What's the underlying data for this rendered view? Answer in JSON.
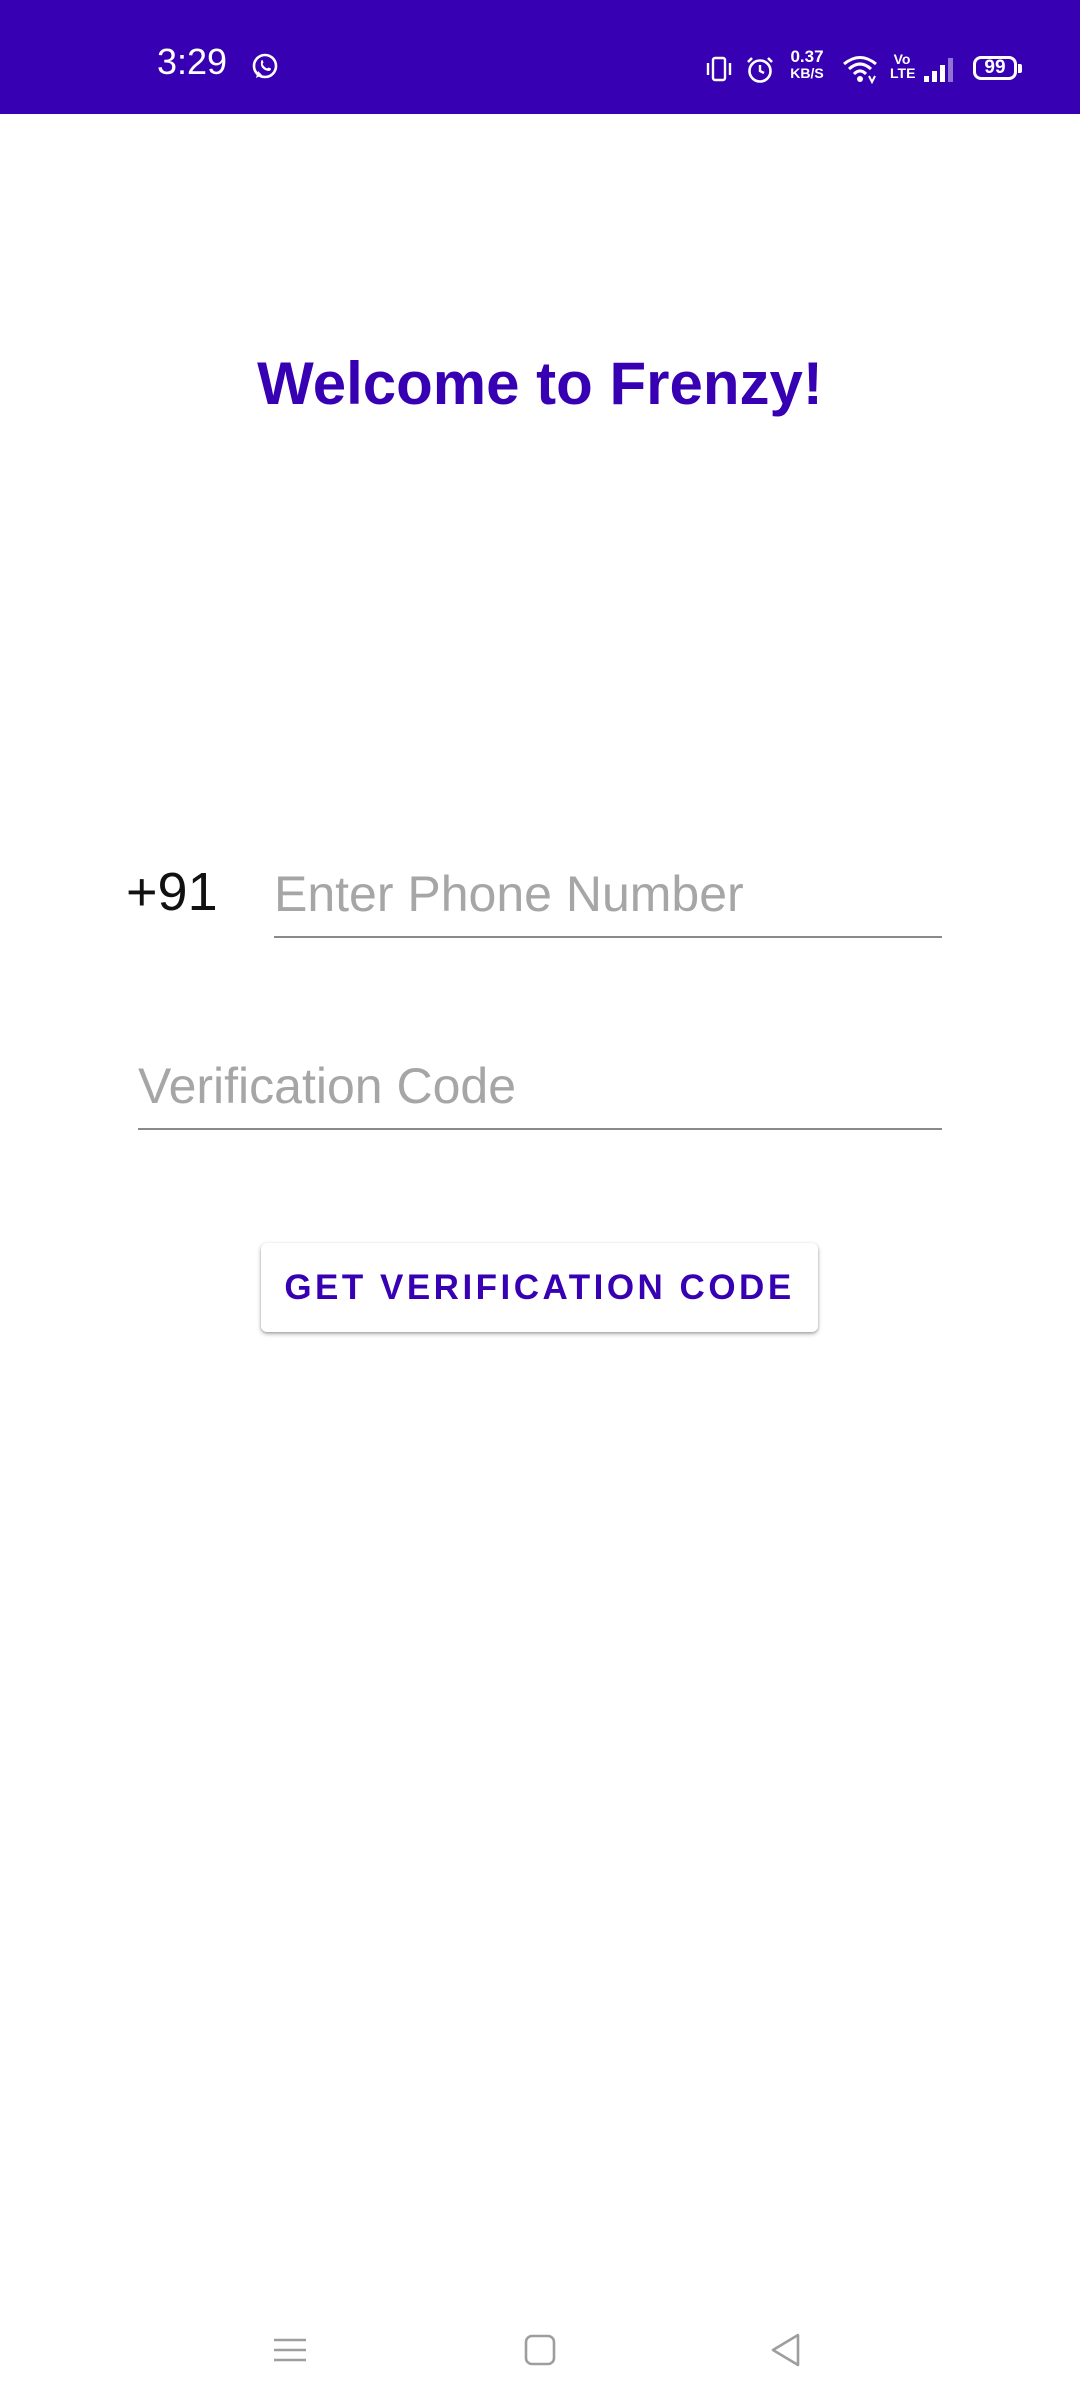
{
  "status_bar": {
    "time": "3:29",
    "net_speed_value": "0.37",
    "net_speed_unit": "KB/S",
    "volte_line1": "Vo",
    "volte_line2": "LTE",
    "battery": "99",
    "background_color": "#3700B3",
    "icons": [
      "whatsapp-icon",
      "vibrate-icon",
      "alarm-icon",
      "wifi-icon",
      "signal-icon",
      "battery-icon"
    ]
  },
  "welcome": {
    "title": "Welcome to Frenzy!"
  },
  "phone": {
    "country_code": "+91",
    "placeholder": "Enter Phone Number",
    "value": ""
  },
  "verification": {
    "placeholder": "Verification Code",
    "value": ""
  },
  "actions": {
    "get_code_label": "GET VERIFICATION CODE"
  },
  "theme": {
    "accent": "#3700B3",
    "placeholder_color": "#A6A6A6",
    "underline_color": "#8A8A8A"
  },
  "nav_bar": {
    "icons": [
      "menu-icon",
      "home-icon",
      "back-icon"
    ]
  }
}
